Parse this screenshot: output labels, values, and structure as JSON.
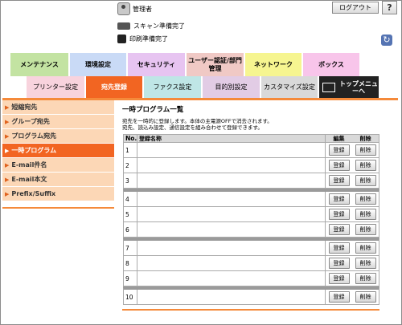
{
  "header": {
    "admin_label": "管理者",
    "logout_label": "ログアウト",
    "help_label": "?",
    "scan_status": "スキャン準備完了",
    "print_status": "印刷準備完了",
    "refresh_icon": "↻"
  },
  "main_tabs": [
    {
      "label": "メンテナンス",
      "color": "#c3e3a2"
    },
    {
      "label": "環境設定",
      "color": "#c9daf6"
    },
    {
      "label": "セキュリティ",
      "color": "#e7c4f1"
    },
    {
      "label": "ユーザー認証/部門管理",
      "color": "#f0c9c5"
    },
    {
      "label": "ネットワーク",
      "color": "#f6f590"
    },
    {
      "label": "ボックス",
      "color": "#f8c5ea"
    }
  ],
  "sub_tabs": [
    {
      "label": "プリンター設定",
      "color": "#f8d3dd"
    },
    {
      "label": "宛先登録",
      "color": "#f26522"
    },
    {
      "label": "ファクス設定",
      "color": "#bfe6e6"
    },
    {
      "label": "目的別設定",
      "color": "#e2cce5"
    },
    {
      "label": "カスタマイズ設定",
      "color": "#d9d9d9"
    },
    {
      "label": "トップメニューへ",
      "color": "#222222"
    }
  ],
  "sidebar": {
    "items": [
      {
        "label": "短縮宛先"
      },
      {
        "label": "グループ宛先"
      },
      {
        "label": "プログラム宛先"
      },
      {
        "label": "一時プログラム"
      },
      {
        "label": "E-mail件名"
      },
      {
        "label": "E-mail本文"
      },
      {
        "label": "Prefix/Suffix"
      }
    ],
    "arrow": "▶"
  },
  "content": {
    "title": "一時プログラム一覧",
    "desc_line1": "宛先を一時的に登録します。本体の主電源OFFで消去されます。",
    "desc_line2": "宛先、読込み設定、通信設定を組み合わせて登録できます。",
    "table": {
      "headers": {
        "no": "No.",
        "name": "登録名称",
        "edit": "編集",
        "delete": "削除"
      },
      "register_label": "登録",
      "delete_label": "削除",
      "rows": [
        "1",
        "2",
        "3",
        "4",
        "5",
        "6",
        "7",
        "8",
        "9",
        "10"
      ]
    }
  }
}
